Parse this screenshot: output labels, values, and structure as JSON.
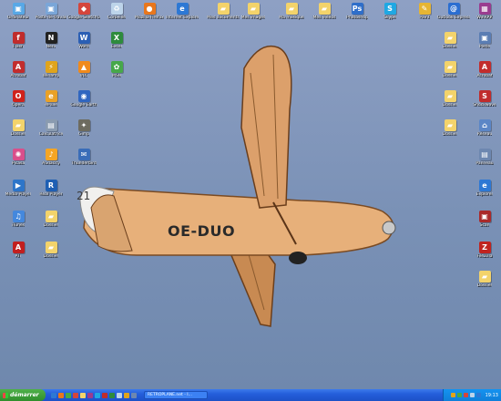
{
  "desktop_icons": [
    {
      "name": "icon-1",
      "label": "Ordinateur",
      "color": "#58a8e6",
      "glyph": "▣"
    },
    {
      "name": "icon-2",
      "label": "Poste de travail",
      "color": "#7aa6d8",
      "glyph": "▣"
    },
    {
      "name": "icon-3",
      "label": "Google SketchUp",
      "color": "#d4453c",
      "glyph": "◆"
    },
    {
      "name": "icon-4",
      "label": "Corbeille",
      "color": "#bdd4ea",
      "glyph": "♻"
    },
    {
      "name": "icon-5",
      "label": "Mozilla Firefox",
      "color": "#e8771d",
      "glyph": "●"
    },
    {
      "name": "icon-6",
      "label": "Internet Explorer",
      "color": "#2d78d4",
      "glyph": "e"
    },
    {
      "name": "icon-7",
      "label": "Mes documents",
      "color": "#f3d36b",
      "glyph": "▰"
    },
    {
      "name": "icon-8",
      "label": "Mes images",
      "color": "#f3d36b",
      "glyph": "▰"
    },
    {
      "name": "icon-9",
      "label": "Ma musique",
      "color": "#f3d36b",
      "glyph": "▰"
    },
    {
      "name": "icon-10",
      "label": "Mes vidéos",
      "color": "#f3d36b",
      "glyph": "▰"
    },
    {
      "name": "icon-11",
      "label": "Photoshop",
      "color": "#2f6ec9",
      "glyph": "Ps"
    },
    {
      "name": "icon-12",
      "label": "Skype",
      "color": "#1fa8e3",
      "glyph": "S"
    },
    {
      "name": "icon-13",
      "label": "Paint",
      "color": "#e6b533",
      "glyph": "✎"
    },
    {
      "name": "icon-14",
      "label": "Outlook Express",
      "color": "#2b6ed1",
      "glyph": "@"
    },
    {
      "name": "icon-15",
      "label": "WinRAR",
      "color": "#9a3c8f",
      "glyph": "▦"
    },
    {
      "name": "icon-16",
      "label": "Flash",
      "color": "#c02c2c",
      "glyph": "f"
    },
    {
      "name": "icon-17",
      "label": "Nero",
      "color": "#222222",
      "glyph": "N"
    },
    {
      "name": "icon-18",
      "label": "Word",
      "color": "#2b5fb4",
      "glyph": "W"
    },
    {
      "name": "icon-19",
      "label": "Excel",
      "color": "#2e8b3d",
      "glyph": "X"
    },
    {
      "name": "icon-20",
      "label": "Acrobat",
      "color": "#c22d2d",
      "glyph": "A"
    },
    {
      "name": "icon-21",
      "label": "Winamp",
      "color": "#e0a41c",
      "glyph": "⚡"
    },
    {
      "name": "icon-22",
      "label": "VLC",
      "color": "#f08a1c",
      "glyph": "▲"
    },
    {
      "name": "icon-23",
      "label": "MSN",
      "color": "#47a84a",
      "glyph": "✿"
    },
    {
      "name": "icon-24",
      "label": "Opera",
      "color": "#d0221c",
      "glyph": "O"
    },
    {
      "name": "icon-25",
      "label": "eMule",
      "color": "#e9a127",
      "glyph": "e"
    },
    {
      "name": "icon-26",
      "label": "Google Earth",
      "color": "#3066c0",
      "glyph": "◉"
    },
    {
      "name": "icon-27",
      "label": "Dossier",
      "color": "#f3d36b",
      "glyph": "▰"
    },
    {
      "name": "icon-28",
      "label": "Calculatrice",
      "color": "#8a9bb0",
      "glyph": "▤"
    },
    {
      "name": "icon-29",
      "label": "Gimp",
      "color": "#6d6b5f",
      "glyph": "✦"
    },
    {
      "name": "icon-30",
      "label": "Picasa",
      "color": "#d94f8b",
      "glyph": "✺"
    },
    {
      "name": "icon-31",
      "label": "Audacity",
      "color": "#f5a524",
      "glyph": "♪"
    },
    {
      "name": "icon-32",
      "label": "Thunderbird",
      "color": "#3a6db8",
      "glyph": "✉"
    },
    {
      "name": "icon-33",
      "label": "Media Player",
      "color": "#2d75c9",
      "glyph": "▶"
    },
    {
      "name": "icon-34",
      "label": "Real Player",
      "color": "#1f5fb3",
      "glyph": "R"
    },
    {
      "name": "icon-35",
      "label": "iTunes",
      "color": "#4488dd",
      "glyph": "♫"
    },
    {
      "name": "icon-36",
      "label": "Dossier",
      "color": "#f3d36b",
      "glyph": "▰"
    },
    {
      "name": "icon-37",
      "label": "ATI",
      "color": "#c21f1f",
      "glyph": "A"
    },
    {
      "name": "icon-38",
      "label": "Dossier",
      "color": "#f3d36b",
      "glyph": "▰"
    },
    {
      "name": "icon-39",
      "label": "Dossier",
      "color": "#f3d36b",
      "glyph": "▰"
    },
    {
      "name": "icon-40",
      "label": "Poste",
      "color": "#5a7db3",
      "glyph": "▣"
    },
    {
      "name": "icon-41",
      "label": "Dossier",
      "color": "#f3d36b",
      "glyph": "▰"
    },
    {
      "name": "icon-42",
      "label": "Acrobat",
      "color": "#c22d2d",
      "glyph": "A"
    },
    {
      "name": "icon-43",
      "label": "Dossier",
      "color": "#f3d36b",
      "glyph": "▰"
    },
    {
      "name": "icon-44",
      "label": "Shockwave",
      "color": "#c02c2c",
      "glyph": "S"
    },
    {
      "name": "icon-45",
      "label": "Dossier",
      "color": "#f3d36b",
      "glyph": "▰"
    },
    {
      "name": "icon-46",
      "label": "Réseau",
      "color": "#5b86c6",
      "glyph": "⌂"
    },
    {
      "name": "icon-47",
      "label": "Panneau",
      "color": "#6d87b0",
      "glyph": "▤"
    },
    {
      "name": "icon-48",
      "label": "Explorer",
      "color": "#2d78d4",
      "glyph": "e"
    },
    {
      "name": "icon-49",
      "label": "Scan",
      "color": "#aa2a2a",
      "glyph": "▣"
    },
    {
      "name": "icon-50",
      "label": "FileZilla",
      "color": "#c0241f",
      "glyph": "Z"
    },
    {
      "name": "icon-51",
      "label": "Dossier",
      "color": "#f3d36b",
      "glyph": "▰"
    }
  ],
  "wallpaper": {
    "glider_registration": "OE-DUO",
    "glider_number": "21"
  },
  "taskbar": {
    "start_label": "démarrer",
    "window_button": "RETROPLANE.net - I...",
    "clock": "19:13"
  },
  "colors": {
    "taskbar": "#245edb",
    "start": "#2f8e2b",
    "tray": "#0f7fd9"
  }
}
